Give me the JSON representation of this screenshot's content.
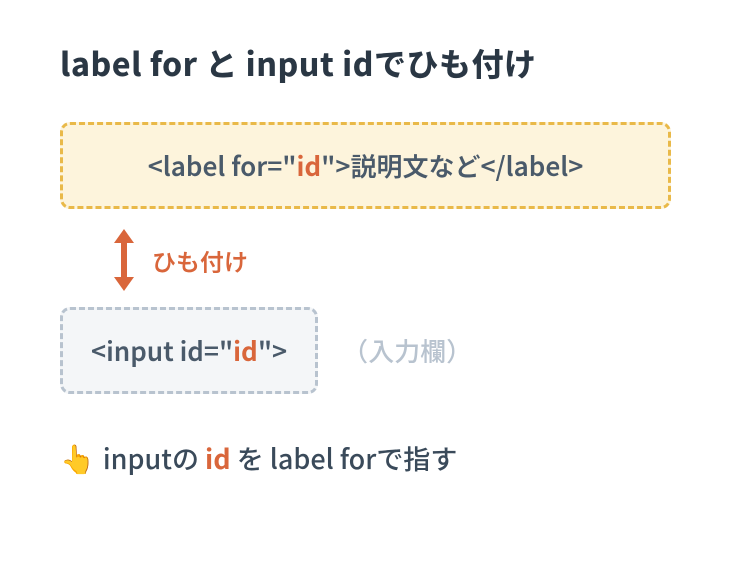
{
  "title": "label for と input idでひも付け",
  "label_code": {
    "open_tag_start": "<label for=\"",
    "id_text": "id",
    "open_tag_end": "\">",
    "inner": "説明文など",
    "close_tag": "</label>"
  },
  "link_label": "ひも付け",
  "input_code": {
    "open_tag_start": "<input id=\"",
    "id_text": "id",
    "open_tag_end": "\">"
  },
  "input_placeholder": "（入力欄）",
  "footer": {
    "pointer": "👆",
    "before_id": "inputの ",
    "id_text": "id",
    "after_id": " を label forで指す"
  },
  "colors": {
    "accent_orange": "#d9663b",
    "box_label_border": "#e9b949",
    "box_label_bg": "#fdf4dc",
    "box_input_border": "#b8c3cf",
    "box_input_bg": "#f4f6f8",
    "text_main": "#2a3744"
  }
}
